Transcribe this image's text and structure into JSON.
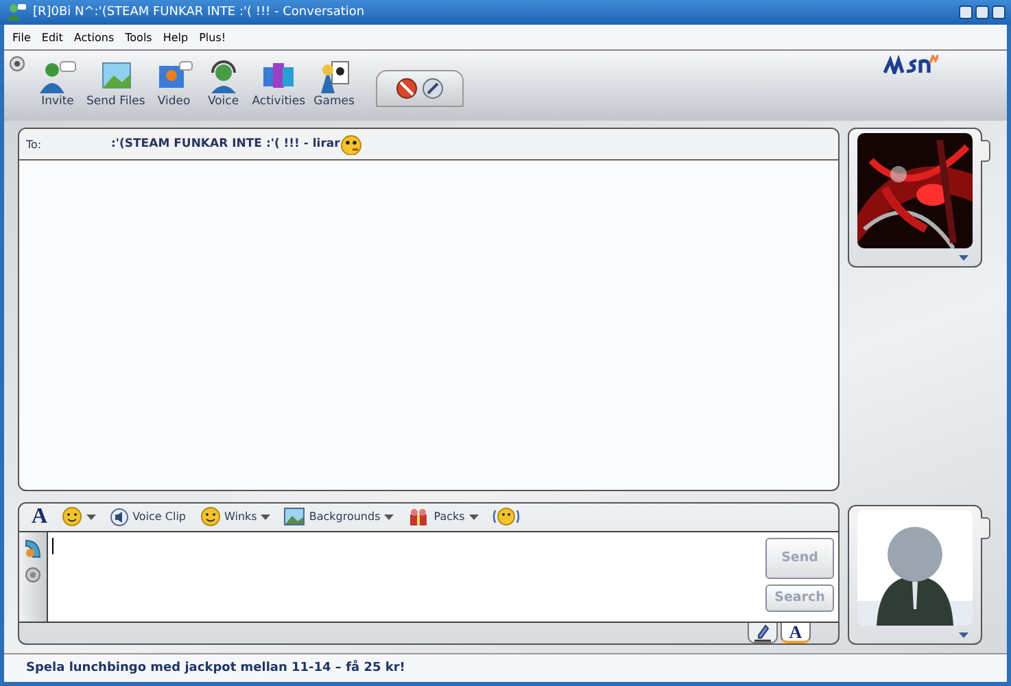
{
  "window": {
    "title": "[R]0Bi N^:'(STEAM FUNKAR INTE :'( !!! - Conversation"
  },
  "menu": [
    "File",
    "Edit",
    "Actions",
    "Tools",
    "Help",
    "Plus!"
  ],
  "toolbar": [
    {
      "kind": "invite",
      "label": "Invite"
    },
    {
      "kind": "files",
      "label": "Send Files"
    },
    {
      "kind": "video",
      "label": "Video"
    },
    {
      "kind": "voice",
      "label": "Voice"
    },
    {
      "kind": "activities",
      "label": "Activities"
    },
    {
      "kind": "games",
      "label": "Games"
    }
  ],
  "to": {
    "label": "To:",
    "name": ":'(STEAM FUNKAR INTE :'( !!! - lirar"
  },
  "format_bar": [
    {
      "kind": "font",
      "glyph": "A"
    },
    {
      "kind": "emoticon",
      "dropdown": true
    },
    {
      "kind": "voiceclip",
      "label": "Voice Clip",
      "dropdown": false
    },
    {
      "kind": "winks",
      "label": "Winks",
      "dropdown": true
    },
    {
      "kind": "backgrounds",
      "label": "Backgrounds",
      "dropdown": true
    },
    {
      "kind": "packs",
      "label": "Packs",
      "dropdown": true
    },
    {
      "kind": "nudge"
    }
  ],
  "buttons": [
    {
      "label": "Send",
      "disabled": true
    },
    {
      "label": "Search",
      "disabled": true
    }
  ],
  "input_tabs": [
    {
      "kind": "handwriting",
      "selected": false
    },
    {
      "kind": "typing",
      "glyph": "A",
      "selected": true
    }
  ],
  "status_bar": {
    "text": "Spela lunchbingo med jackpot mellan 11-14 – få 25 kr!"
  }
}
